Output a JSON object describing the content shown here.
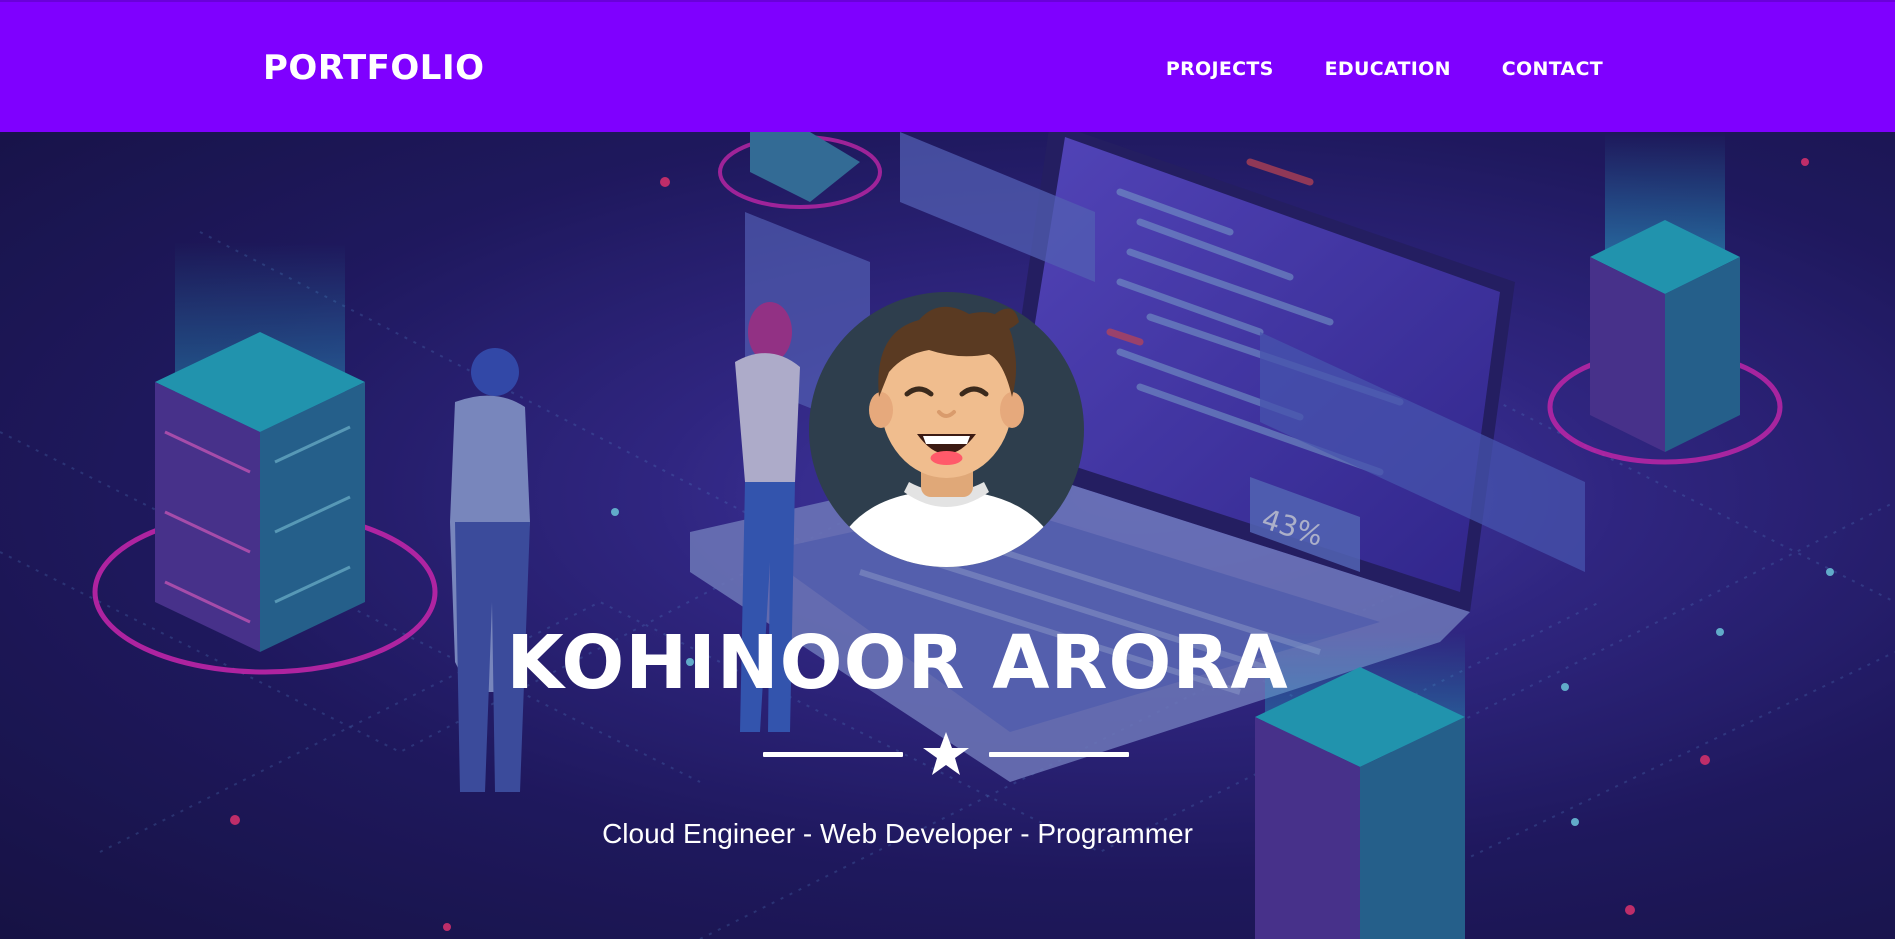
{
  "navbar": {
    "brand": "PORTFOLIO",
    "links": [
      "PROJECTS",
      "EDUCATION",
      "CONTACT"
    ]
  },
  "hero": {
    "name": "KOHINOOR ARORA",
    "subtitle": "Cloud Engineer - Web Developer - Programmer",
    "background_illustration": "isometric-server-laptop-illustration",
    "avatar_icon": "smiling-man-avatar",
    "divider_icon": "star-icon",
    "laptop_screen_badge": "43%"
  },
  "colors": {
    "navbar": "#7f00ff",
    "hero_base": "#231d6b",
    "text": "#ffffff",
    "neon_pink": "#ff2fd0",
    "neon_cyan": "#2ee6ff"
  }
}
